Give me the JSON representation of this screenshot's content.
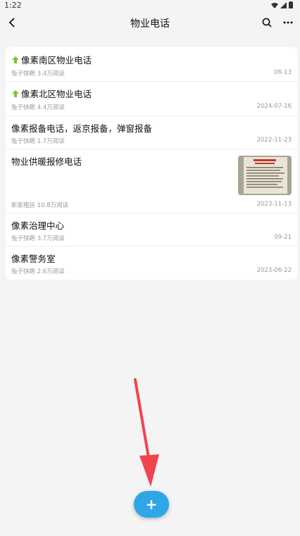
{
  "status_bar": {
    "time": "1:22"
  },
  "app_bar": {
    "title": "物业电话"
  },
  "items": [
    {
      "title": "像素南区物业电话",
      "pinned": true,
      "meta": "兔子快跑 3.4万阅读",
      "date": "06-13"
    },
    {
      "title": "像素北区物业电话",
      "pinned": true,
      "meta": "兔子快跑 4.4万阅读",
      "date": "2024-07-16"
    },
    {
      "title": "像素报备电话，返京报备，弹窗报备",
      "pinned": false,
      "meta": "兔子快跑 1.7万阅读",
      "date": "2022-11-23"
    },
    {
      "title": "物业供暖报修电话",
      "pinned": false,
      "meta": "新家租房 10.8万阅读",
      "date": "2023-11-13",
      "thumbnail": true
    },
    {
      "title": "像素治理中心",
      "pinned": false,
      "meta": "兔子快跑 3.7万阅读",
      "date": "09-21"
    },
    {
      "title": "像素警务室",
      "pinned": false,
      "meta": "兔子快跑 2.6万阅读",
      "date": "2023-06-22"
    }
  ],
  "fab": {
    "label": "+"
  },
  "colors": {
    "accent": "#2fa6e8",
    "pin": "#7cc42a",
    "arrow": "#f0444e"
  },
  "icons": [
    "back-icon",
    "search-icon",
    "more-icon",
    "pin-up-icon",
    "add-icon"
  ]
}
